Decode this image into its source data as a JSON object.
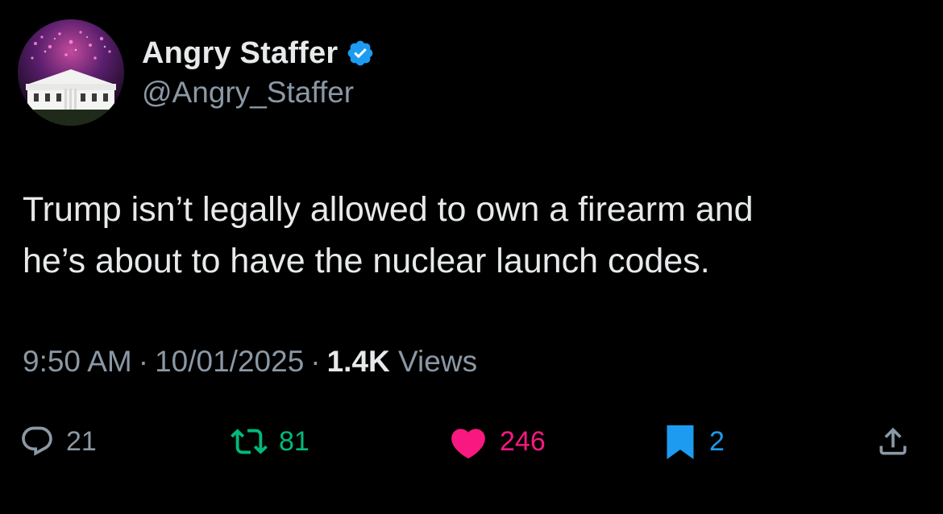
{
  "author": {
    "display_name": "Angry Staffer",
    "handle": "@Angry_Staffer",
    "verified_icon": "verified-badge-icon",
    "avatar_icon": "white-house-fireworks-avatar"
  },
  "tweet": {
    "text_line1": "Trump isn’t legally allowed to own a firearm and",
    "text_line2": "he’s about to have the nuclear launch codes."
  },
  "meta": {
    "time": "9:50 AM",
    "separator": "·",
    "date": "10/01/2025",
    "views_count": "1.4K",
    "views_label": "Views"
  },
  "actions": {
    "reply": {
      "icon": "reply-icon",
      "count": "21"
    },
    "retweet": {
      "icon": "retweet-icon",
      "count": "81"
    },
    "like": {
      "icon": "heart-icon",
      "count": "246"
    },
    "bookmark": {
      "icon": "bookmark-icon",
      "count": "2"
    },
    "share": {
      "icon": "share-icon"
    }
  },
  "colors": {
    "background": "#000000",
    "primary_text": "#e7e9ea",
    "secondary_text": "#8b98a5",
    "verified_blue": "#1d9bf0",
    "retweet_green": "#00ba7c",
    "like_pink": "#f91880",
    "bookmark_blue": "#1d9bf0"
  }
}
